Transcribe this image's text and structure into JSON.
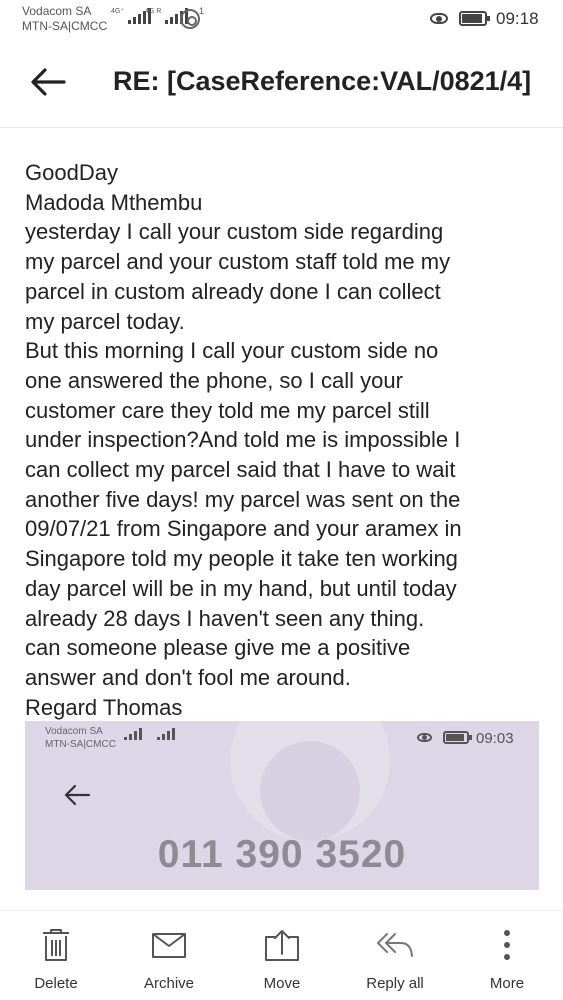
{
  "status_bar": {
    "carrier_1": "Vodacom SA",
    "carrier_2": "MTN-SA|CMCC",
    "signal_1_tag": "4G⁺",
    "signal_2_tag": "4G R",
    "wifi_superscript": "1",
    "time": "09:18"
  },
  "header": {
    "back_icon": "arrow-left-icon",
    "subject": "RE: [CaseReference:VAL/0821/4]"
  },
  "message": {
    "lines": [
      "GoodDay",
      "Madoda Mthembu",
      "yesterday I call your custom side regarding",
      "my parcel and your custom staff told me my",
      "parcel in custom already done I can collect",
      "my parcel today.",
      "But this morning I call your custom side no",
      "one answered the phone, so I call your",
      "customer care they told me  my parcel still",
      "under inspection?And told me is impossible I",
      "can collect my parcel said that I have to wait",
      "another five days! my parcel was sent on the",
      "09/07/21 from Singapore and your aramex in",
      "Singapore told my people it take ten working",
      "day parcel will be in my hand, but until today",
      "already 28 days I haven't seen any thing.",
      "can someone please give me a positive",
      "answer and don't fool me around.",
      "Regard Thomas"
    ]
  },
  "attachment": {
    "carrier_1": "Vodacom SA",
    "carrier_2": "MTN-SA|CMCC",
    "time": "09:03",
    "phone_number": "011 390 3520",
    "back_icon": "arrow-left-icon"
  },
  "actions": [
    {
      "label": "Delete",
      "icon": "trash-icon"
    },
    {
      "label": "Archive",
      "icon": "archive-icon"
    },
    {
      "label": "Move",
      "icon": "move-icon"
    },
    {
      "label": "Reply all",
      "icon": "reply-all-icon"
    },
    {
      "label": "More",
      "icon": "more-vertical-icon"
    }
  ],
  "colors": {
    "attachment_background": "#dcd6e6",
    "number_text": "#8d8a94"
  }
}
